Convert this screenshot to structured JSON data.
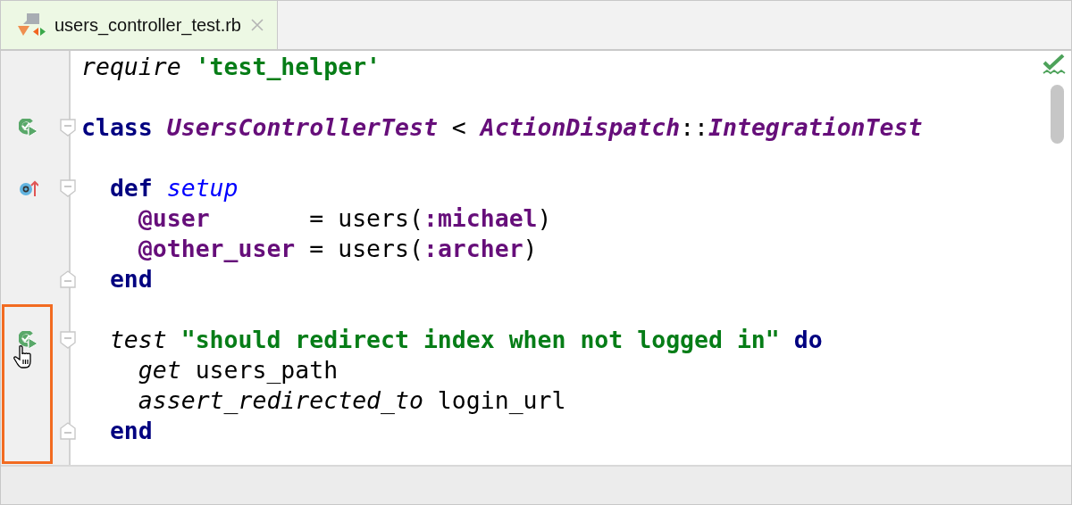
{
  "tab": {
    "label": "users_controller_test.rb",
    "selected": true
  },
  "lines": [
    {
      "kind": "code",
      "tokens": [
        {
          "text": "require ",
          "kind": "call"
        },
        {
          "text": "'test_helper'",
          "kind": "string"
        }
      ]
    },
    {
      "kind": "blank"
    },
    {
      "kind": "code",
      "fold": {
        "kind": "start"
      },
      "gutter": {
        "kind": "run"
      },
      "tokens": [
        {
          "text": "class ",
          "kind": "keyword"
        },
        {
          "text": "UsersControllerTest",
          "kind": "constant"
        },
        {
          "text": " < ",
          "kind": "plain"
        },
        {
          "text": "ActionDispatch",
          "kind": "constant"
        },
        {
          "text": "::",
          "kind": "plain"
        },
        {
          "text": "IntegrationTest",
          "kind": "constant"
        }
      ]
    },
    {
      "kind": "blank"
    },
    {
      "kind": "code",
      "fold": {
        "kind": "start"
      },
      "gutter": {
        "kind": "override"
      },
      "tokens": [
        {
          "text": "  def ",
          "kind": "keyword"
        },
        {
          "text": "setup",
          "kind": "method"
        }
      ]
    },
    {
      "kind": "code",
      "tokens": [
        {
          "text": "    @user",
          "kind": "ivar"
        },
        {
          "text": "       = users(",
          "kind": "plain"
        },
        {
          "text": ":michael",
          "kind": "symbol"
        },
        {
          "text": ")",
          "kind": "plain"
        }
      ]
    },
    {
      "kind": "code",
      "tokens": [
        {
          "text": "    @other_user",
          "kind": "ivar"
        },
        {
          "text": " = users(",
          "kind": "plain"
        },
        {
          "text": ":archer",
          "kind": "symbol"
        },
        {
          "text": ")",
          "kind": "plain"
        }
      ]
    },
    {
      "kind": "code",
      "fold": {
        "kind": "end"
      },
      "tokens": [
        {
          "text": "  end",
          "kind": "keyword"
        }
      ]
    },
    {
      "kind": "blank"
    },
    {
      "kind": "code",
      "highlighted": true,
      "fold": {
        "kind": "start"
      },
      "gutter": {
        "kind": "run",
        "cursor": true
      },
      "tokens": [
        {
          "text": "  test ",
          "kind": "call"
        },
        {
          "text": "\"should redirect index when not logged in\"",
          "kind": "string"
        },
        {
          "text": " do",
          "kind": "keyword"
        }
      ]
    },
    {
      "kind": "code",
      "highlighted": true,
      "tokens": [
        {
          "text": "    get ",
          "kind": "call"
        },
        {
          "text": "users_path",
          "kind": "plain"
        }
      ]
    },
    {
      "kind": "code",
      "highlighted": true,
      "tokens": [
        {
          "text": "    assert_redirected_to ",
          "kind": "call"
        },
        {
          "text": "login_url",
          "kind": "plain"
        }
      ]
    },
    {
      "kind": "code",
      "highlighted": true,
      "fold": {
        "kind": "end"
      },
      "tokens": [
        {
          "text": "  end",
          "kind": "keyword"
        }
      ]
    }
  ]
}
